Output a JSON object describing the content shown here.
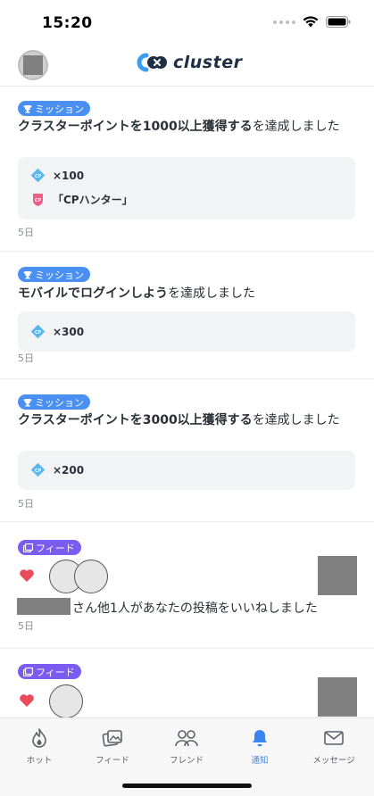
{
  "status_bar": {
    "time": "15:20"
  },
  "header": {
    "logo_text": "cluster"
  },
  "notifications": [
    {
      "type": "mission",
      "badge": "ミッション",
      "title_bold": "クラスターポイントを1000以上獲得する",
      "title_rest": "を達成しました",
      "rewards": [
        {
          "icon": "cp-point-icon",
          "label": "×100"
        },
        {
          "icon": "title-badge-icon",
          "label": "「CPハンター」"
        }
      ],
      "time": "5日"
    },
    {
      "type": "mission",
      "badge": "ミッション",
      "title_bold": "モバイルでログインしよう",
      "title_rest": "を達成しました",
      "rewards": [
        {
          "icon": "cp-point-icon",
          "label": "×300"
        }
      ],
      "time": "5日"
    },
    {
      "type": "mission",
      "badge": "ミッション",
      "title_bold": "クラスターポイントを3000以上獲得する",
      "title_rest": "を達成しました",
      "rewards": [
        {
          "icon": "cp-point-icon",
          "label": "×200"
        }
      ],
      "time": "5日"
    },
    {
      "type": "feed",
      "badge": "フィード",
      "text": "さん他1人があなたの投稿をいいねしました",
      "time": "5日"
    },
    {
      "type": "feed",
      "badge": "フィード"
    }
  ],
  "tabbar": {
    "items": [
      {
        "label": "ホット",
        "icon": "flame-icon"
      },
      {
        "label": "フィード",
        "icon": "photos-icon"
      },
      {
        "label": "フレンド",
        "icon": "friends-icon"
      },
      {
        "label": "通知",
        "icon": "bell-icon",
        "active": true
      },
      {
        "label": "メッセージ",
        "icon": "mail-icon"
      }
    ]
  },
  "colors": {
    "mission_badge": "#4a90f2",
    "feed_badge": "#7a5cf0",
    "active_tab": "#3a86f0",
    "heart": "#e94b5a"
  }
}
